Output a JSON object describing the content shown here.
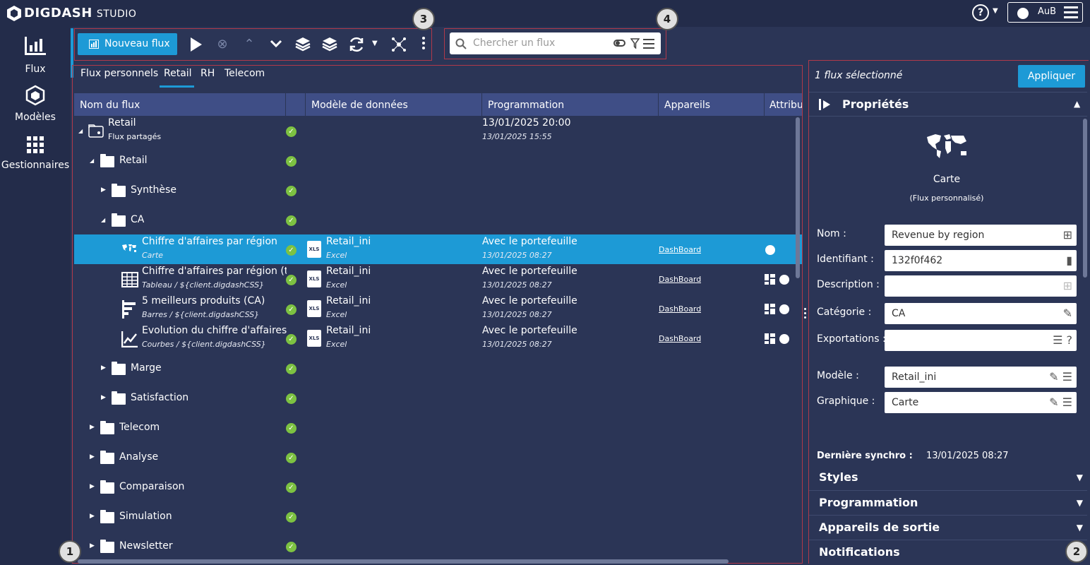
{
  "app": {
    "brand": "DIGDASH",
    "product": "STUDIO",
    "user": "AuB"
  },
  "rail": [
    {
      "label": "Flux",
      "icon": "chart-bars-icon"
    },
    {
      "label": "Modèles",
      "icon": "cube-icon"
    },
    {
      "label": "Gestionnaires",
      "icon": "grid-icon"
    }
  ],
  "toolbar": {
    "new_flow": "Nouveau flux"
  },
  "search": {
    "placeholder": "Chercher un flux"
  },
  "badges": [
    "1",
    "2",
    "3",
    "4"
  ],
  "tabs": [
    "Flux personnels",
    "Retail",
    "RH",
    "Telecom"
  ],
  "grid": {
    "headers": [
      "Nom du flux",
      "Modèle de données",
      "Programmation",
      "Appareils",
      "Attribu"
    ],
    "root": {
      "name": "Retail",
      "sub": "Flux partagés",
      "sched1": "13/01/2025 20:00",
      "sched2": "13/01/2025 15:55"
    },
    "folders": [
      "Retail",
      "Synthèse",
      "CA",
      "Marge",
      "Satisfaction",
      "Telecom",
      "Analyse",
      "Comparaison",
      "Simulation",
      "Newsletter"
    ],
    "flows": [
      {
        "name": "Chiffre d'affaires par région",
        "sub": "Carte",
        "model": "Retail_ini",
        "model_sub": "Excel",
        "sched": "Avec le portefeuille",
        "sched_sub": "13/01/2025 08:27",
        "device": "DashBoard",
        "icon": "world-map-icon"
      },
      {
        "name": "Chiffre d'affaires par région (t...",
        "sub": "Tableau / ${client.digdashCSS}",
        "model": "Retail_ini",
        "model_sub": "Excel",
        "sched": "Avec le portefeuille",
        "sched_sub": "13/01/2025 08:27",
        "device": "DashBoard",
        "icon": "table-icon"
      },
      {
        "name": "5 meilleurs produits (CA)",
        "sub": "Barres / ${client.digdashCSS}",
        "model": "Retail_ini",
        "model_sub": "Excel",
        "sched": "Avec le portefeuille",
        "sched_sub": "13/01/2025 08:27",
        "device": "DashBoard",
        "icon": "bar-chart-icon"
      },
      {
        "name": "Evolution du chiffre d'affaires",
        "sub": "Courbes / ${client.digdashCSS}",
        "model": "Retail_ini",
        "model_sub": "Excel",
        "sched": "Avec le portefeuille",
        "sched_sub": "13/01/2025 08:27",
        "device": "DashBoard",
        "icon": "line-chart-icon"
      }
    ],
    "xls_label": "XLS"
  },
  "panel": {
    "selected": "1 flux sélectionné",
    "apply": "Appliquer",
    "properties": "Propriétés",
    "chart_name": "Carte",
    "chart_kind": "(Flux personnalisé)",
    "labels": {
      "nom": "Nom :",
      "id": "Identifiant :",
      "desc": "Description :",
      "cat": "Catégorie :",
      "exp": "Exportations :",
      "model": "Modèle :",
      "graph": "Graphique :",
      "sync": "Dernière synchro :"
    },
    "values": {
      "nom": "Revenue by region",
      "id": "132f0f462",
      "desc": "",
      "cat": "CA",
      "exp": "",
      "model": "Retail_ini",
      "graph": "Carte",
      "sync": "13/01/2025 08:27"
    },
    "sections": [
      "Styles",
      "Programmation",
      "Appareils de sortie",
      "Notifications"
    ]
  },
  "colors": {
    "accent": "#1d9ad6",
    "bg": "#2b3556",
    "rail": "#232c4a",
    "header": "#3f4e86",
    "ok": "#7dc242",
    "annot": "#b0394a"
  }
}
